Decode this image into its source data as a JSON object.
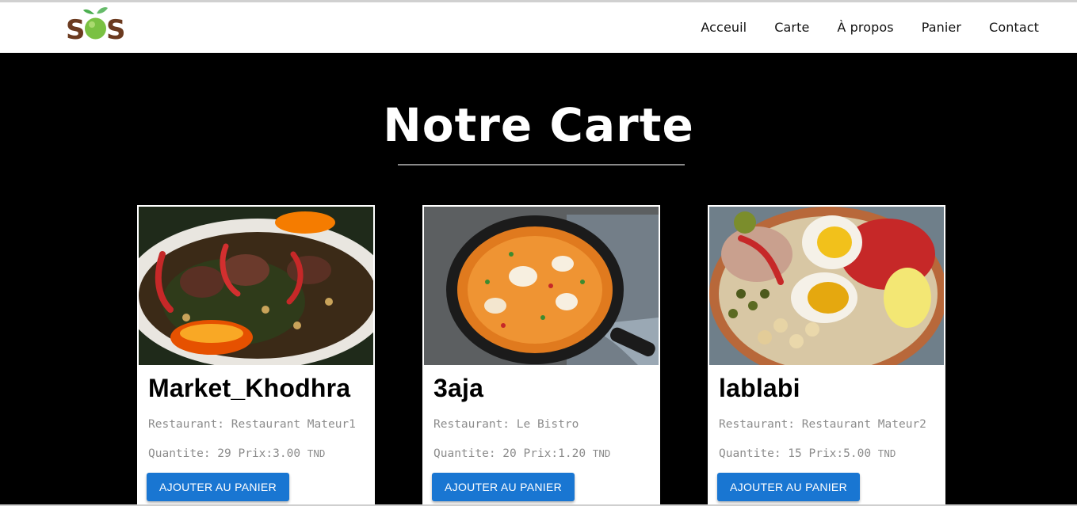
{
  "header": {
    "logo_text": "SOS",
    "nav": [
      {
        "label": "Acceuil"
      },
      {
        "label": "Carte"
      },
      {
        "label": "À propos"
      },
      {
        "label": "Panier"
      },
      {
        "label": "Contact"
      }
    ]
  },
  "main": {
    "title": "Notre Carte",
    "cards": [
      {
        "name": "Market_Khodhra",
        "restaurant": "Restaurant: Restaurant Mateur1",
        "quantity": "Quantite: 29 Prix:3.00",
        "currency": "TND",
        "button": "AJOUTER AU PANIER"
      },
      {
        "name": "3aja",
        "restaurant": "Restaurant: Le Bistro",
        "quantity": "Quantite: 20 Prix:1.20",
        "currency": "TND",
        "button": "AJOUTER AU PANIER"
      },
      {
        "name": "lablabi",
        "restaurant": "Restaurant: Restaurant Mateur2",
        "quantity": "Quantite: 15 Prix:5.00",
        "currency": "TND",
        "button": "AJOUTER AU PANIER"
      }
    ]
  },
  "colors": {
    "background": "#000000",
    "header_bg": "#ffffff",
    "button": "#1976d2",
    "logo_green": "#7ac142",
    "logo_brown": "#6b3a1f"
  }
}
